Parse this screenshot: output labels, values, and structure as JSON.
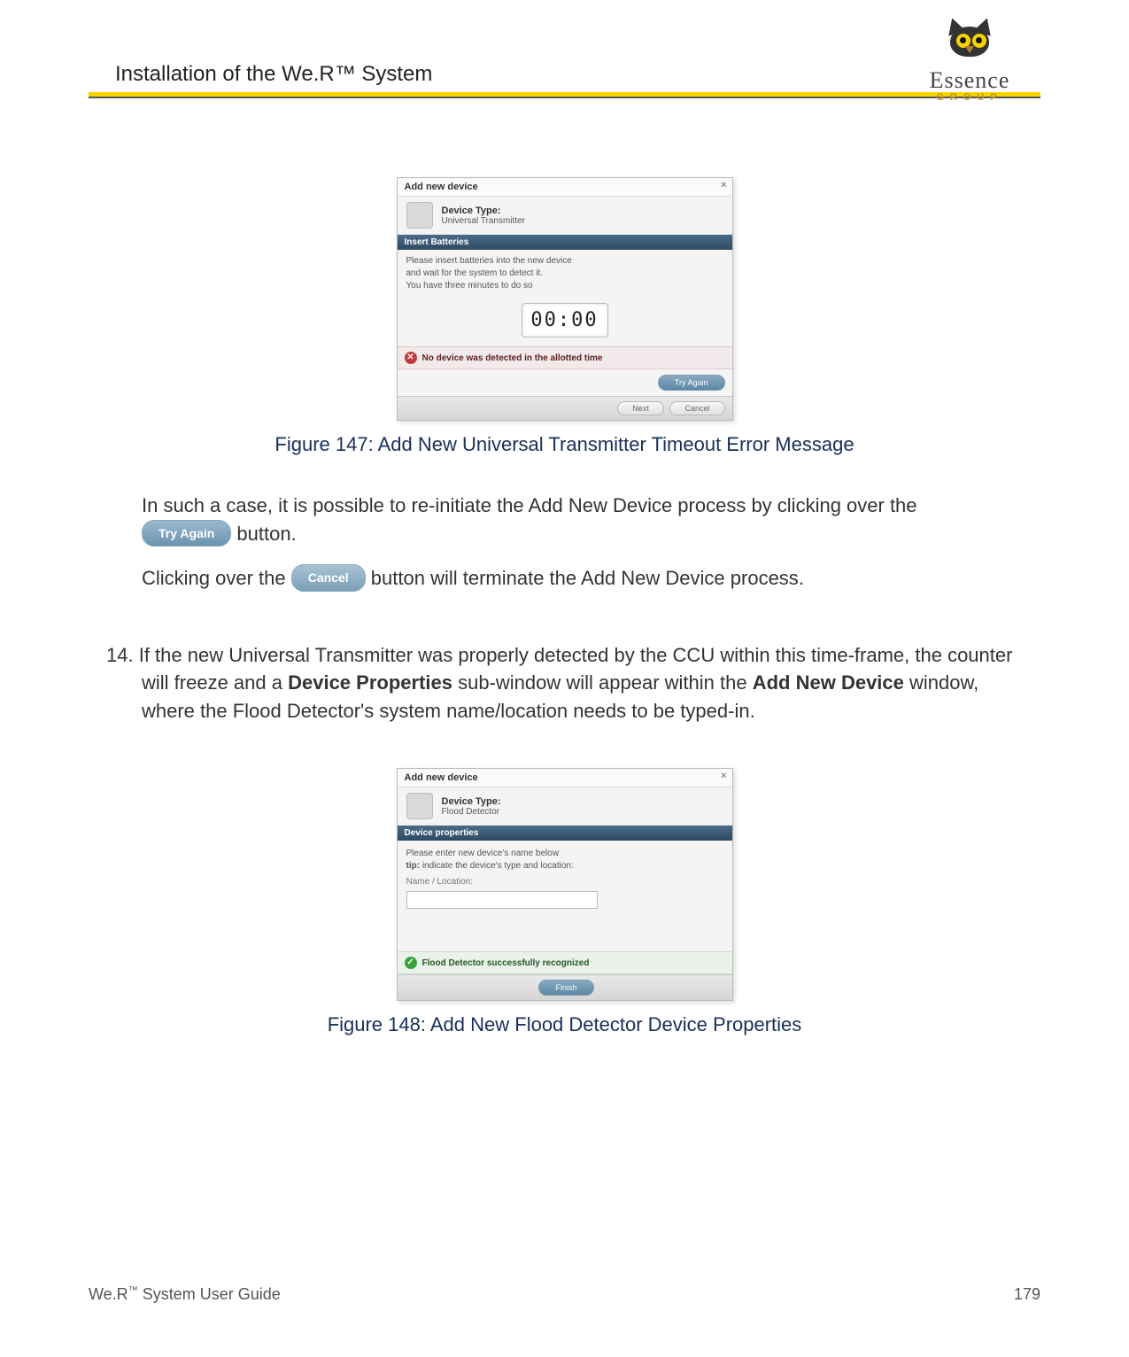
{
  "header": {
    "section_title": "Installation of the We.R™ System",
    "logo_text": "Essence",
    "logo_group": "GROUP"
  },
  "figure_147": {
    "dlg_title": "Add new device",
    "close_glyph": "×",
    "device_type_label": "Device Type:",
    "device_type_value": "Universal Transmitter",
    "step_bar": "Insert Batteries",
    "instr_line1": "Please insert batteries into the new device",
    "instr_line2": "and wait for the system to detect it.",
    "instr_line3": "You have three minutes to do so",
    "timer": "00:00",
    "alert_icon": "✕",
    "alert_text": "No device was detected in the allotted time",
    "try_again_btn": "Try Again",
    "footer_next": "Next",
    "footer_cancel": "Cancel",
    "caption": "Figure 147: Add New Universal Transmitter Timeout Error Message"
  },
  "body_text": {
    "p1_pre": "In such a case, it is possible to re-initiate the Add New Device process by clicking over the ",
    "try_again_pill": "Try Again",
    "p1_post": " button.",
    "p2_pre": "Clicking over the ",
    "cancel_pill": "Cancel",
    "p2_post": " button will terminate the Add New Device process.",
    "step_number": "14.",
    "step_pre": "If the new Universal Transmitter was properly detected by the CCU within this time-frame, the counter will freeze and a ",
    "step_bold1": "Device Properties",
    "step_mid": " sub-window will appear within the ",
    "step_bold2": "Add New Device",
    "step_post": " window, where the Flood Detector's system name/location needs to be typed-in."
  },
  "figure_148": {
    "dlg_title": "Add new device",
    "close_glyph": "×",
    "device_type_label": "Device Type:",
    "device_type_value": "Flood Detector",
    "step_bar": "Device properties",
    "instr_line1": "Please enter new device's name below",
    "tip_label": "tip:",
    "tip_text": " indicate the device's type and location:",
    "name_loc_label": "Name / Location:",
    "success_icon": "✓",
    "success_text": "Flood Detector successfully recognized",
    "finish_btn": "Finish",
    "caption": "Figure 148: Add New Flood Detector Device Properties"
  },
  "footer": {
    "guide_pre": "We.R",
    "guide_sup": "™",
    "guide_post": " System User Guide",
    "page_num": "179"
  }
}
